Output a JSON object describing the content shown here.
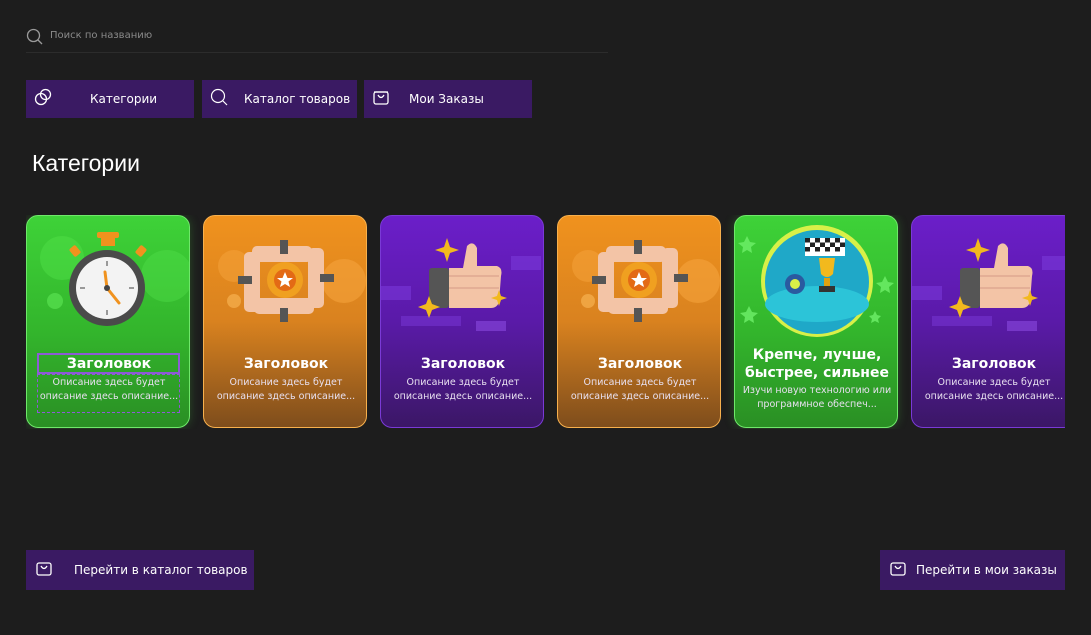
{
  "search": {
    "placeholder": "Поиск по названию"
  },
  "nav": [
    {
      "label": "Категории",
      "icon": "categories-icon"
    },
    {
      "label": "Каталог товаров",
      "icon": "search-icon"
    },
    {
      "label": "Мои Заказы",
      "icon": "bag-icon"
    }
  ],
  "section": {
    "title": "Категории"
  },
  "cards": [
    {
      "title": "Заголовок",
      "desc": "Описание здесь будет описание здесь описание...",
      "theme": "green",
      "icon": "stopwatch-icon"
    },
    {
      "title": "Заголовок",
      "desc": "Описание здесь будет описание здесь описание...",
      "theme": "orange",
      "icon": "teamwork-hands-icon"
    },
    {
      "title": "Заголовок",
      "desc": "Описание здесь будет описание здесь описание...",
      "theme": "purple",
      "icon": "thumbs-up-icon"
    },
    {
      "title": "Заголовок",
      "desc": "Описание здесь будет описание здесь описание...",
      "theme": "orange",
      "icon": "teamwork-hands-icon"
    },
    {
      "title": "Крепче, лучше, быстрее, сильнее",
      "title_line1": "Крепче, лучше,",
      "title_line2": "быстрее, сильнее",
      "desc": "Изучи новую технологию или программное обеспеч...",
      "theme": "green",
      "icon": "trophy-race-icon"
    },
    {
      "title": "Заголовок",
      "desc": "Описание здесь будет описание здесь описание...",
      "theme": "purple",
      "icon": "thumbs-up-icon"
    }
  ],
  "bottom": {
    "catalog_label": "Перейти в каталог товаров",
    "orders_label": "Перейти в мои заказы"
  },
  "colors": {
    "accent": "#3a1a63",
    "background": "#1d1d1d",
    "green": "#3ed238",
    "orange": "#f0921e",
    "purple": "#6b1ec9"
  }
}
